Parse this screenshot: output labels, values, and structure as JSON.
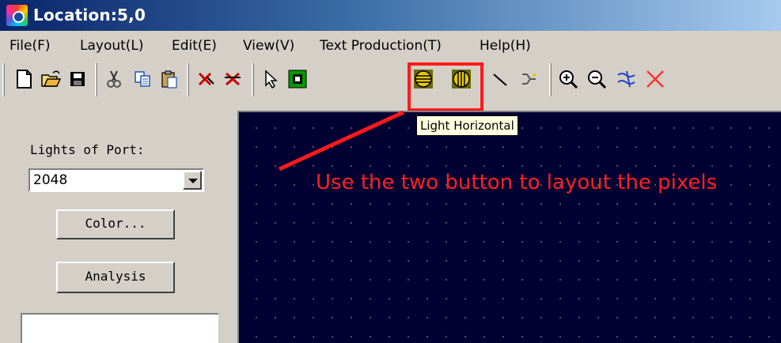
{
  "window": {
    "title": "Location:5,0"
  },
  "menu": [
    {
      "label": "File(F)"
    },
    {
      "label": "Layout(L)"
    },
    {
      "label": "Edit(E)"
    },
    {
      "label": "View(V)"
    },
    {
      "label": "Text Production(T)"
    },
    {
      "label": "Help(H)"
    }
  ],
  "toolbar": {
    "buttons": [
      {
        "icon": "new-document-icon"
      },
      {
        "icon": "open-folder-icon"
      },
      {
        "icon": "save-icon"
      },
      {
        "icon": "cut-icon"
      },
      {
        "icon": "copy-icon"
      },
      {
        "icon": "paste-icon"
      },
      {
        "icon": "delete-icon"
      },
      {
        "icon": "delete-all-icon"
      },
      {
        "icon": "pointer-icon"
      },
      {
        "icon": "light-single-icon"
      },
      {
        "icon": "light-horizontal-icon"
      },
      {
        "icon": "light-vertical-icon"
      },
      {
        "icon": "line-icon"
      },
      {
        "icon": "connect-icon"
      },
      {
        "icon": "zoom-in-icon"
      },
      {
        "icon": "zoom-out-icon"
      },
      {
        "icon": "wave-icon"
      },
      {
        "icon": "close-x-icon"
      }
    ],
    "tooltip": "Light Horizontal"
  },
  "left_panel": {
    "lights_label": "Lights of Port:",
    "port_value": "2048",
    "color_button": "Color...",
    "analysis_button": "Analysis"
  },
  "annotation": {
    "text": "Use the two button to layout the pixels",
    "color": "#ff2020"
  },
  "colors": {
    "canvas": "#000033",
    "highlight": "#ff1a1a",
    "tooltip_bg": "#ffffe1"
  }
}
